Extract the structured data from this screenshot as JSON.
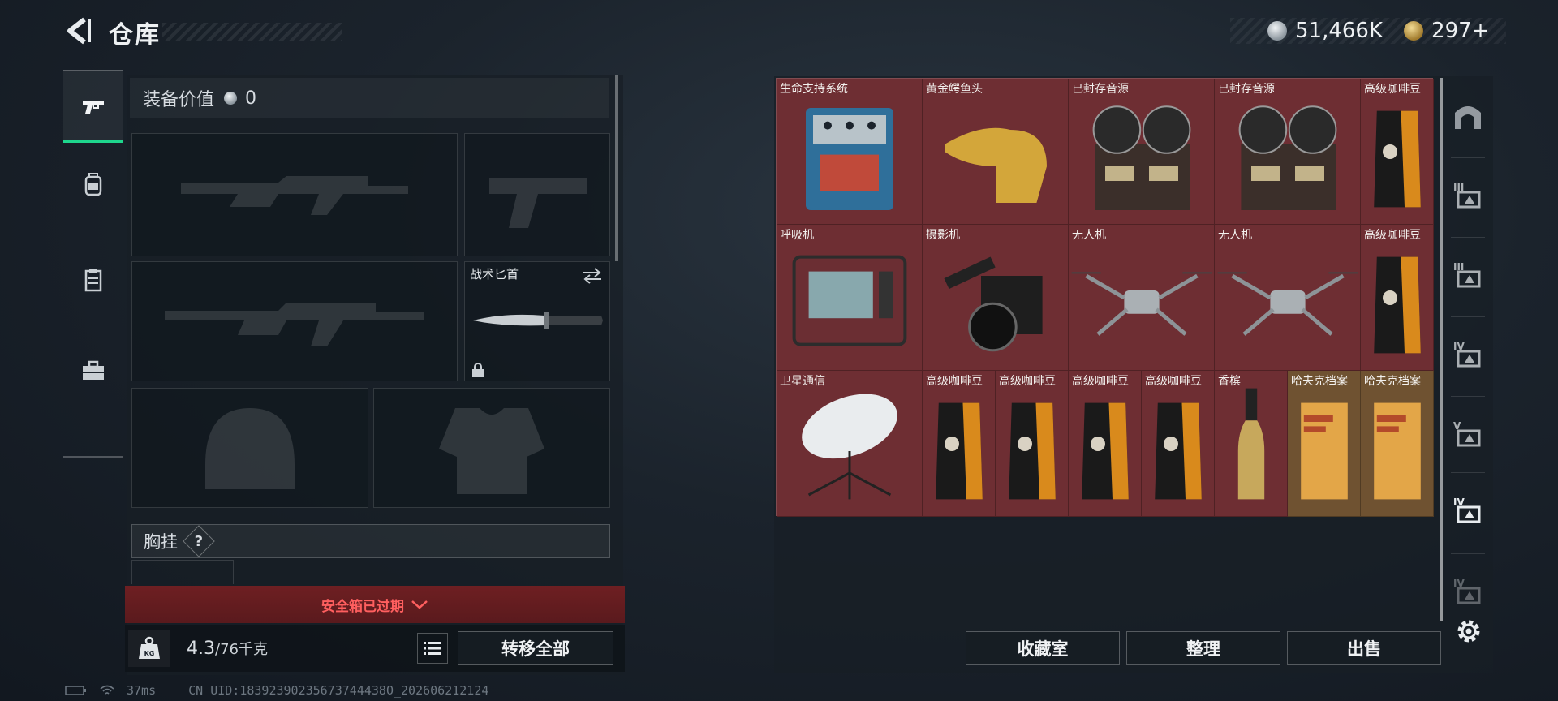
{
  "header": {
    "title": "仓库",
    "back_icon": "back-arrow-icon"
  },
  "currency": [
    {
      "icon": "silver-coin-icon",
      "value": "51,466K"
    },
    {
      "icon": "gold-coin-icon",
      "value": "297+"
    }
  ],
  "left_tabs": [
    {
      "icon": "pistol-icon",
      "active": true
    },
    {
      "icon": "backpack-icon",
      "active": false
    },
    {
      "icon": "clipboard-icon",
      "active": false
    },
    {
      "icon": "briefcase-icon",
      "active": false
    }
  ],
  "equipment": {
    "value_label": "装备价值",
    "value": "0",
    "secondary_weapon_label": "战术匕首",
    "vest_label": "胸挂",
    "vest_badge": "?"
  },
  "safe_box": {
    "label": "安全箱已过期"
  },
  "capacity": {
    "current": "4.3",
    "max": "/76千克"
  },
  "buttons": {
    "transfer_all": "转移全部",
    "collection": "收藏室",
    "organize": "整理",
    "sell": "出售"
  },
  "stash_items": [
    {
      "label": "生命支持系统",
      "color": "red",
      "icon": "life-support-icon"
    },
    {
      "label": "黄金鳄鱼头",
      "color": "red",
      "icon": "gold-croc-head-icon"
    },
    {
      "label": "已封存音源",
      "color": "red",
      "icon": "reel-recorder-icon"
    },
    {
      "label": "已封存音源",
      "color": "red",
      "icon": "reel-recorder-icon"
    },
    {
      "label": "高级咖啡豆",
      "color": "red",
      "icon": "coffee-bag-icon"
    },
    {
      "label": "呼吸机",
      "color": "red",
      "icon": "ventilator-icon"
    },
    {
      "label": "摄影机",
      "color": "red",
      "icon": "camera-icon"
    },
    {
      "label": "无人机",
      "color": "red",
      "icon": "drone-icon"
    },
    {
      "label": "无人机",
      "color": "red",
      "icon": "drone-icon"
    },
    {
      "label": "高级咖啡豆",
      "color": "red",
      "icon": "coffee-bag-icon"
    },
    {
      "label": "卫星通信",
      "color": "red",
      "icon": "satellite-dish-icon"
    },
    {
      "label": "高级咖啡豆",
      "color": "red",
      "icon": "coffee-bag-icon"
    },
    {
      "label": "高级咖啡豆",
      "color": "red",
      "icon": "coffee-bag-icon"
    },
    {
      "label": "高级咖啡豆",
      "color": "red",
      "icon": "coffee-bag-icon"
    },
    {
      "label": "高级咖啡豆",
      "color": "red",
      "icon": "coffee-bag-icon"
    },
    {
      "label": "香槟",
      "color": "red",
      "icon": "champagne-icon"
    },
    {
      "label": "哈夫克档案",
      "color": "orange",
      "icon": "file-folder-icon"
    },
    {
      "label": "哈夫克档案",
      "color": "orange",
      "icon": "file-folder-icon"
    }
  ],
  "right_rail": [
    {
      "icon": "stash-arch-icon"
    },
    {
      "icon": "stash-III-icon",
      "text": "III"
    },
    {
      "icon": "stash-III-icon",
      "text": "III"
    },
    {
      "icon": "stash-IV-icon",
      "text": "IV"
    },
    {
      "icon": "stash-V-icon",
      "text": "V"
    },
    {
      "icon": "stash-IV-icon",
      "text": "IV"
    },
    {
      "icon": "stash-IV-icon",
      "text": "IV"
    }
  ],
  "status": {
    "ping": "37ms",
    "uid": "CN UID:18392390235673744438O_202606212124"
  },
  "colors": {
    "accent_green": "#1ed68d",
    "alert_red": "#ff5f5f",
    "rare_red": "#6e2e33",
    "legendary_orange": "#6f5231"
  }
}
